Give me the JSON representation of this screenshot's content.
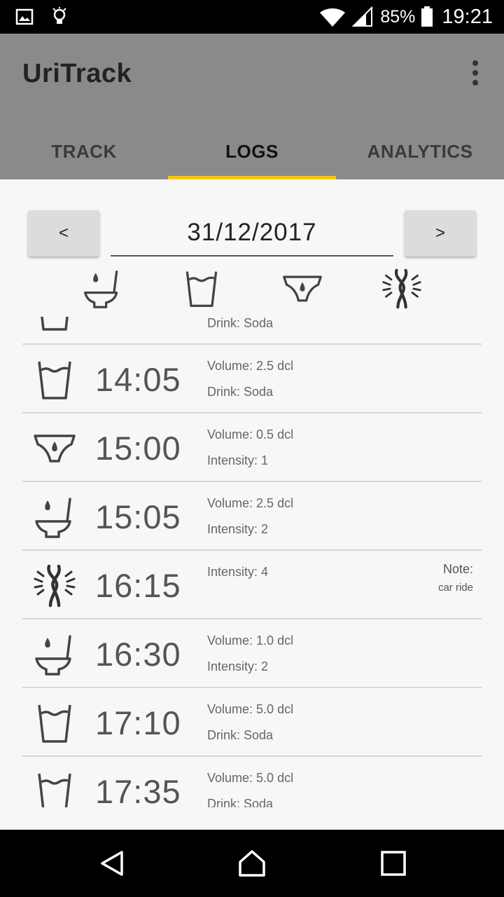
{
  "status_bar": {
    "battery_percent": "85%",
    "time": "19:21",
    "icons": [
      "image-icon",
      "lightbulb-icon",
      "wifi-icon",
      "signal-icon",
      "battery-icon"
    ]
  },
  "app": {
    "title": "UriTrack"
  },
  "tabs": [
    {
      "label": "TRACK",
      "active": false
    },
    {
      "label": "LOGS",
      "active": true
    },
    {
      "label": "ANALYTICS",
      "active": false
    }
  ],
  "date_nav": {
    "prev_label": "<",
    "next_label": ">",
    "date": "31/12/2017"
  },
  "filters": [
    "toilet-icon",
    "glass-icon",
    "underwear-icon",
    "urgency-icon"
  ],
  "partial_top_row": {
    "detail": "Drink: Soda"
  },
  "logs": [
    {
      "icon": "glass-icon",
      "time": "14:05",
      "detail1": "Volume: 2.5 dcl",
      "detail2": "Drink: Soda"
    },
    {
      "icon": "underwear-icon",
      "time": "15:00",
      "detail1": "Volume: 0.5 dcl",
      "detail2": "Intensity: 1"
    },
    {
      "icon": "toilet-icon",
      "time": "15:05",
      "detail1": "Volume: 2.5 dcl",
      "detail2": "Intensity: 2"
    },
    {
      "icon": "urgency-icon",
      "time": "16:15",
      "detail1": "Intensity: 4",
      "detail2": "",
      "note_label": "Note:",
      "note_text": "car ride"
    },
    {
      "icon": "toilet-icon",
      "time": "16:30",
      "detail1": "Volume: 1.0 dcl",
      "detail2": "Intensity: 2"
    },
    {
      "icon": "glass-icon",
      "time": "17:10",
      "detail1": "Volume: 5.0 dcl",
      "detail2": "Drink: Soda"
    },
    {
      "icon": "glass-icon",
      "time": "17:35",
      "detail1": "Volume: 5.0 dcl",
      "detail2": "Drink: Soda"
    }
  ],
  "colors": {
    "app_bar": "#8a8a8a",
    "tab_indicator": "#f5c518",
    "background": "#f7f7f7"
  },
  "nav_bar": {
    "icons": [
      "back-icon",
      "home-icon",
      "recents-icon"
    ]
  }
}
